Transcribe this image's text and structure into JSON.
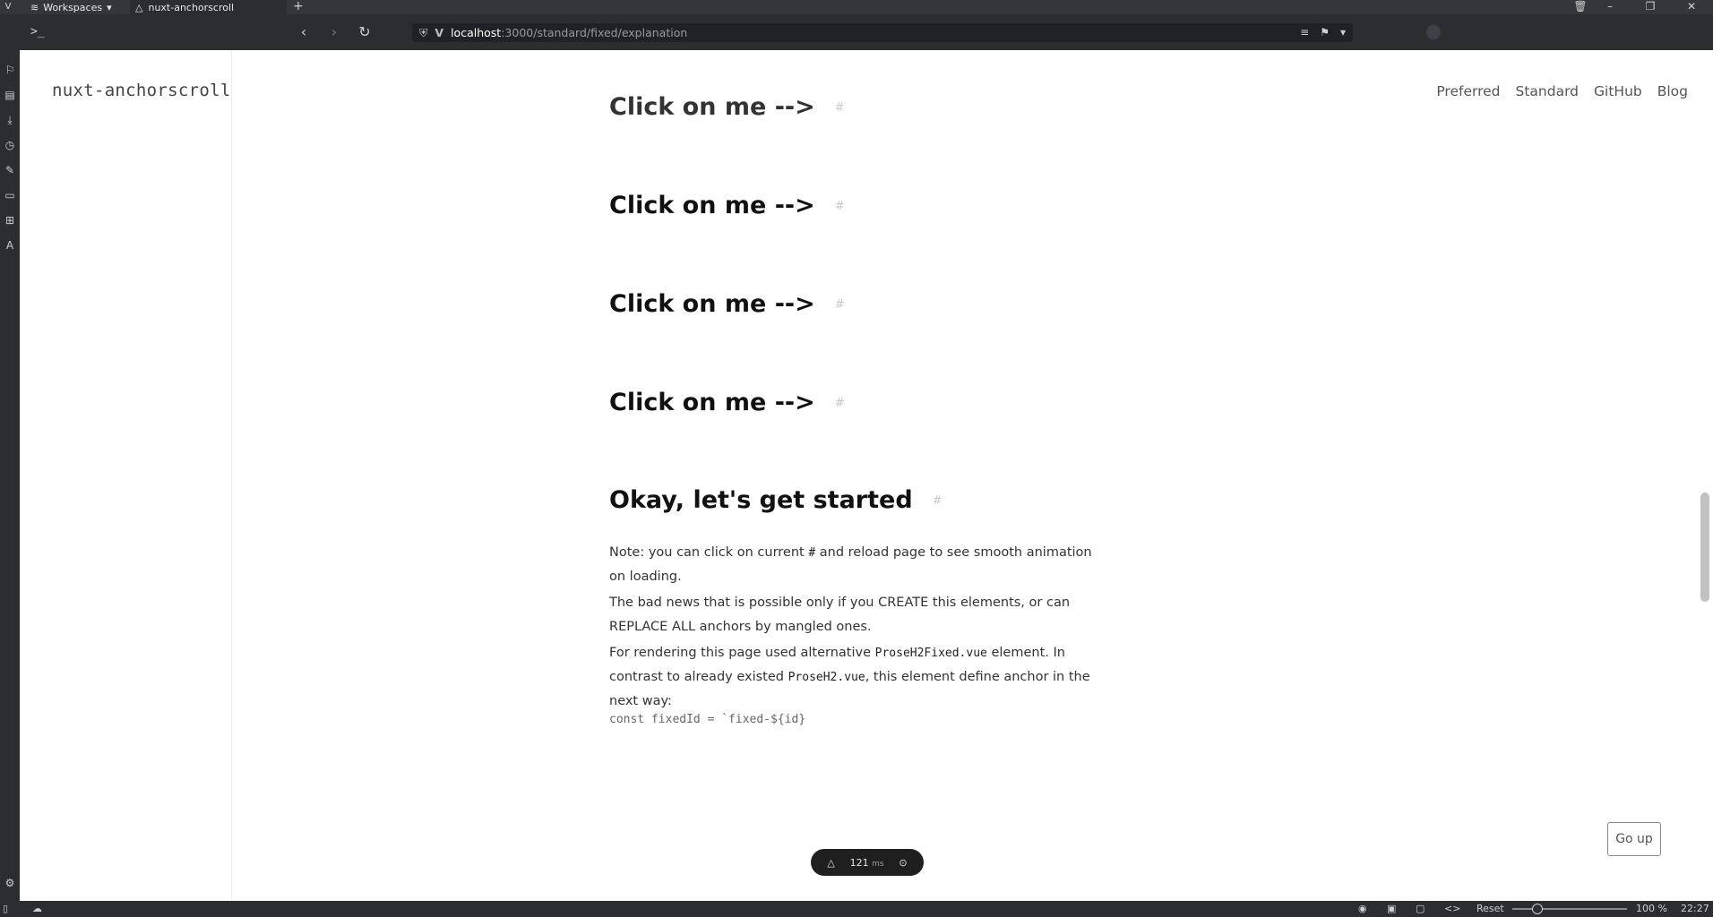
{
  "browser": {
    "workspaces_label": "Workspaces",
    "tab_title": "nuxt-anchorscroll",
    "new_tab": "+",
    "url_host": "localhost",
    "url_path": ":3000/standard/fixed/explanation"
  },
  "statusbar": {
    "reset_label": "Reset",
    "zoom": "100 %",
    "time": "22:27"
  },
  "site": {
    "title": "nuxt-anchorscroll",
    "nav": [
      "Preferred",
      "Standard",
      "GitHub",
      "Blog"
    ]
  },
  "article": {
    "headings": [
      "Click on me -->",
      "Click on me -->",
      "Click on me -->",
      "Click on me -->",
      "Okay, let's get started"
    ],
    "anchor_glyph": "#",
    "paragraphs": {
      "note_a": "Note: you can click on current ",
      "note_hash": "#",
      "note_b": " and reload page to see smooth animation on loading.",
      "bad_news": "The bad news that is possible only if you CREATE this elements, or can REPLACE ALL anchors by mangled ones.",
      "rendering_a": "For rendering this page used alternative ",
      "rendering_code1": "ProseH2Fixed.vue",
      "rendering_b": " element. In contrast to already existed ",
      "rendering_code2": "ProseH2.vue",
      "rendering_c": ", this element define anchor in the next way:"
    },
    "code_snippet": "const fixedId = `fixed-${id}"
  },
  "go_up_label": "Go up",
  "devtools": {
    "timing_value": "121",
    "timing_unit": "ms"
  }
}
